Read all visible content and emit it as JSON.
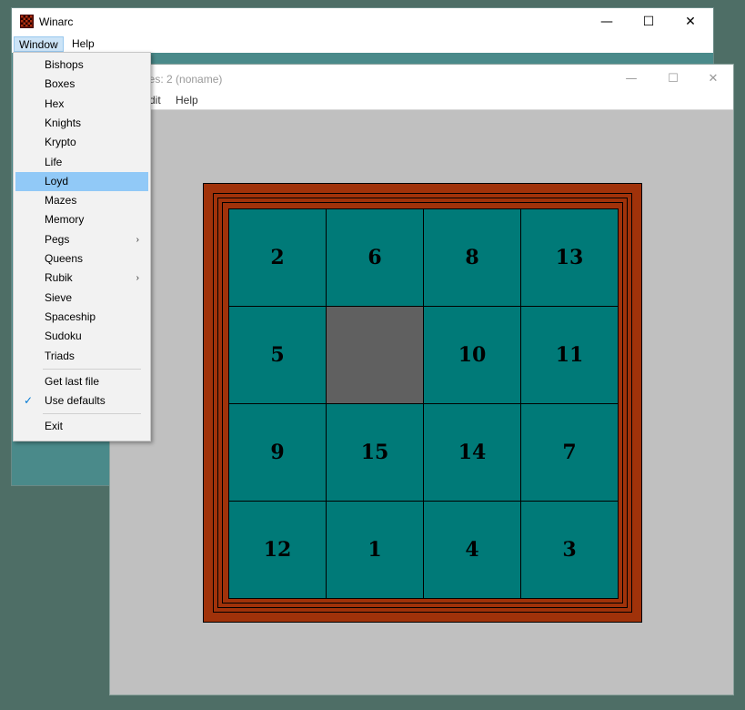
{
  "back_window": {
    "title": "Winarc",
    "menus": [
      "Window",
      "Help"
    ],
    "controls": {
      "minimize": "—",
      "maximize": "☐",
      "close": "✕"
    }
  },
  "front_window": {
    "title": "oves: 2 (noname)",
    "menus": [
      "dit",
      "Help"
    ],
    "controls": {
      "minimize": "—",
      "maximize": "☐",
      "close": "✕"
    }
  },
  "board": {
    "tiles": [
      "2",
      "6",
      "8",
      "13",
      "5",
      "",
      "10",
      "11",
      "9",
      "15",
      "14",
      "7",
      "12",
      "1",
      "4",
      "3"
    ],
    "blank_index": 5,
    "colors": {
      "tile": "#007a78",
      "blank": "#606060",
      "frame": "#a0320a",
      "background": "#c0c0c0"
    }
  },
  "window_menu": {
    "items": [
      {
        "label": "Bishops"
      },
      {
        "label": "Boxes"
      },
      {
        "label": "Hex"
      },
      {
        "label": "Knights"
      },
      {
        "label": "Krypto"
      },
      {
        "label": "Life"
      },
      {
        "label": "Loyd",
        "highlighted": true
      },
      {
        "label": "Mazes"
      },
      {
        "label": "Memory"
      },
      {
        "label": "Pegs",
        "submenu": true
      },
      {
        "label": "Queens"
      },
      {
        "label": "Rubik",
        "submenu": true
      },
      {
        "label": "Sieve"
      },
      {
        "label": "Spaceship"
      },
      {
        "label": "Sudoku"
      },
      {
        "label": "Triads"
      }
    ],
    "extra_items": [
      {
        "label": "Get last file"
      },
      {
        "label": "Use defaults",
        "checked": true
      }
    ],
    "exit_label": "Exit",
    "submenu_glyph": "›",
    "check_glyph": "✓"
  }
}
